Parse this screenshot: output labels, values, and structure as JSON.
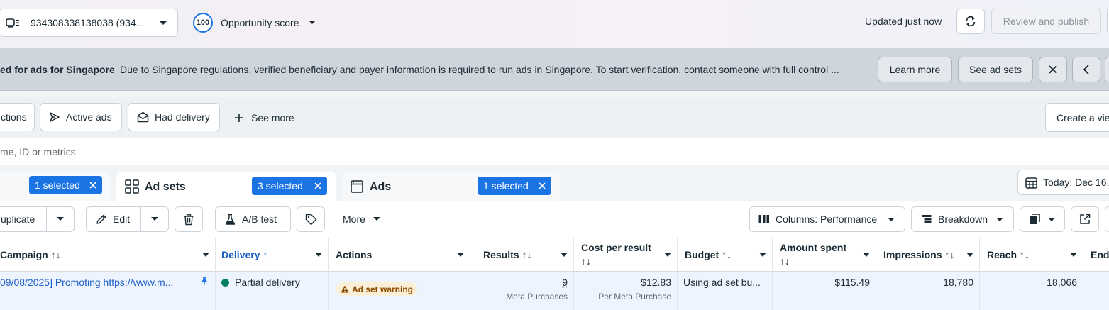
{
  "topbar": {
    "account_label": "934308338138038 (934...",
    "opportunity_score_value": "100",
    "opportunity_score_label": "Opportunity score",
    "updated_text": "Updated just now",
    "review_publish_label": "Review and publish"
  },
  "banner": {
    "title": "ed for ads for Singapore",
    "message": "Due to Singapore regulations, verified beneficiary and payer information is required to run ads in Singapore. To start verification, contact someone with full control ...",
    "learn_more_label": "Learn more",
    "see_ad_sets_label": "See ad sets"
  },
  "filters": {
    "items": [
      {
        "label": "ctions"
      },
      {
        "label": "Active ads"
      },
      {
        "label": "Had delivery"
      }
    ],
    "see_more_label": "See more",
    "create_view_label": "Create a vie"
  },
  "search": {
    "placeholder": "me, ID or metrics"
  },
  "tabs": {
    "campaigns_selected": "1 selected",
    "adsets_label": "Ad sets",
    "adsets_selected": "3 selected",
    "ads_label": "Ads",
    "ads_selected": "1 selected",
    "date_label": "Today: Dec 16,"
  },
  "toolbar": {
    "duplicate_label": "uplicate",
    "edit_label": "Edit",
    "ab_test_label": "A/B test",
    "more_label": "More",
    "columns_label": "Columns: Performance",
    "breakdown_label": "Breakdown"
  },
  "table": {
    "headers": {
      "campaign": "Campaign ↑↓",
      "delivery": "Delivery ↑",
      "actions": "Actions",
      "results": "Results ↑↓",
      "cost_per_result_line1": "Cost per result",
      "cost_per_result_line2": "↑↓",
      "budget": "Budget ↑↓",
      "amount_spent_line1": "Amount spent",
      "amount_spent_line2": "↑↓",
      "impressions": "Impressions ↑↓",
      "reach": "Reach ↑↓",
      "ends": "End"
    },
    "row": {
      "campaign": "09/08/2025] Promoting https://www.m...",
      "delivery": "Partial delivery",
      "actions": "Ad set warning",
      "results_value": "9",
      "results_sub": "Meta Purchases",
      "cost_value": "$12.83",
      "cost_sub": "Per Meta Purchase",
      "budget": "Using ad set bu...",
      "amount_spent": "$115.49",
      "impressions": "18,780",
      "reach": "18,066"
    }
  },
  "colors": {
    "accent_blue": "#1b74e4",
    "delivery_green": "#00805f",
    "warning_bg": "#fcefd7",
    "warning_text": "#8a4b00",
    "link_blue": "#1d5fc7"
  },
  "icons": [
    "ad-account-icon",
    "chevron-down-icon",
    "refresh-icon",
    "close-icon",
    "chevron-left-icon",
    "send-icon",
    "envelope-icon",
    "plus-icon",
    "grid-icon",
    "ad-icon",
    "pencil-icon",
    "trash-icon",
    "flask-icon",
    "tag-icon",
    "columns-icon",
    "breakdown-icon",
    "report-icon",
    "export-icon",
    "calendar-icon",
    "pin-icon",
    "warning-icon"
  ]
}
